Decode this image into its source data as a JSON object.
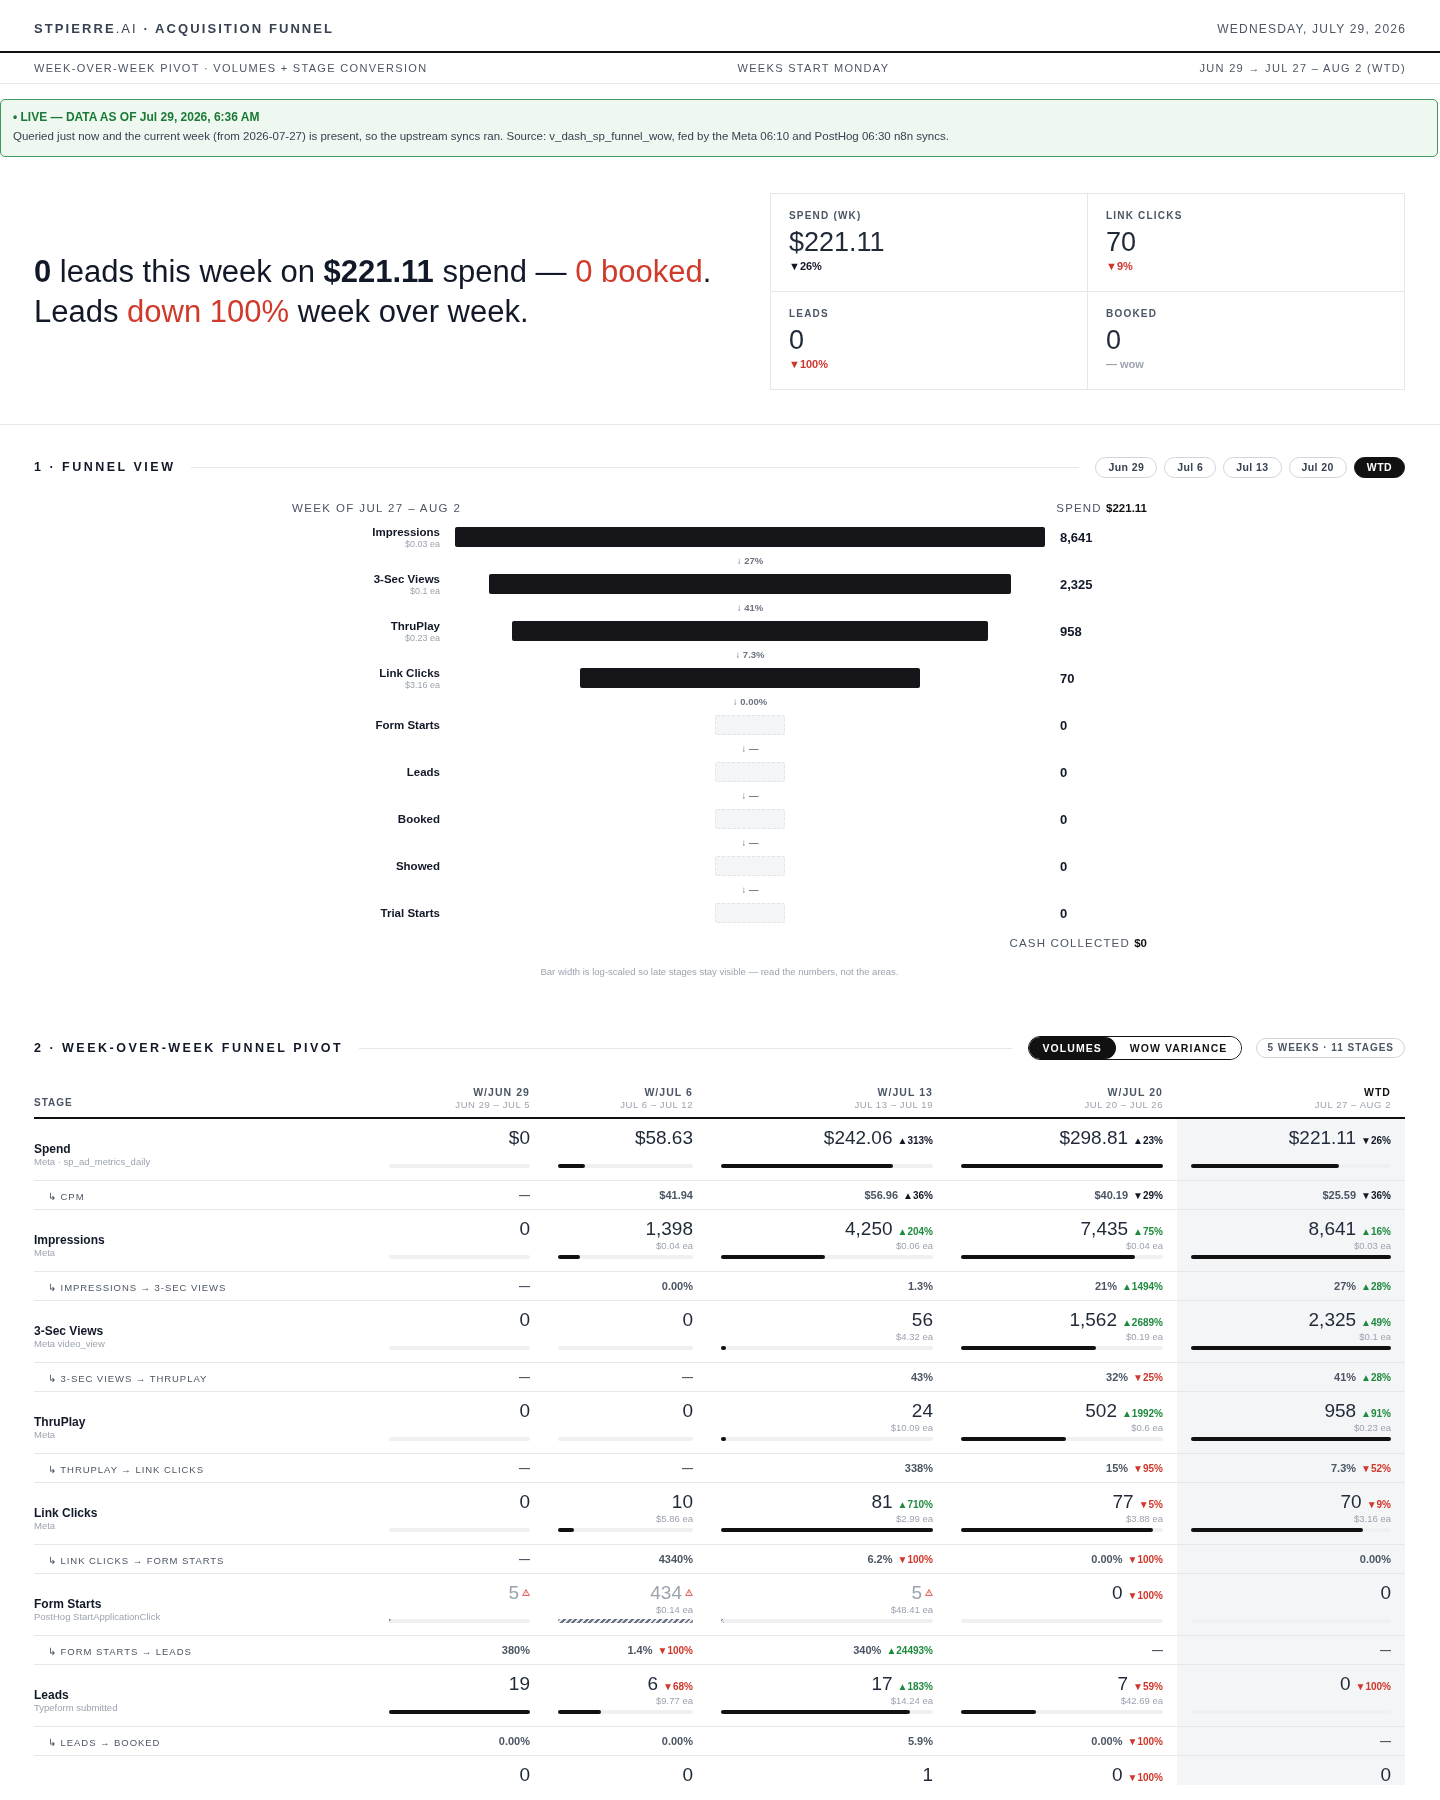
{
  "header": {
    "title": "**STPIERRE**.AI **· ACQUISITION FUNNEL**",
    "date": "WEDNESDAY, JULY 29, 2026"
  },
  "subheader": {
    "left": "WEEK-OVER-WEEK PIVOT · VOLUMES + STAGE CONVERSION",
    "center": "WEEKS START MONDAY",
    "right": "JUN 29 → JUL 27 – AUG 2 (WTD)"
  },
  "banner": {
    "status": "• LIVE — DATA AS OF Jul 29, 2026, 6:36 AM",
    "message": "Queried just now and the current week (from 2026-07-27) is present, so the upstream syncs ran. Source: v_dash_sp_funnel_wow, fed by the Meta 06:10 and PostHog 06:30 n8n syncs."
  },
  "hero": {
    "lines": [
      [
        {
          "text": "0",
          "kind": "strong"
        },
        {
          "text": " leads this week on ",
          "kind": "plain"
        },
        {
          "text": "$221.11",
          "kind": "strong"
        },
        {
          "text": " spend — ",
          "kind": "plain"
        },
        {
          "text": "0 booked",
          "kind": "alert"
        },
        {
          "text": ".",
          "kind": "plain"
        }
      ],
      [
        {
          "text": "Leads ",
          "kind": "plain"
        },
        {
          "text": "down 100%",
          "kind": "alert"
        },
        {
          "text": " week over week.",
          "kind": "plain"
        }
      ]
    ]
  },
  "kpis": [
    {
      "label": "SPEND (WK)",
      "value": "$221.11",
      "change": {
        "text": "▼26%",
        "color": "#111827"
      }
    },
    {
      "label": "LINK CLICKS",
      "value": "70",
      "change": {
        "text": "▼9%",
        "color": "#d0362a"
      }
    },
    {
      "label": "LEADS",
      "value": "0",
      "change": {
        "text": "▼100%",
        "color": "#d0362a"
      }
    },
    {
      "label": "BOOKED",
      "value": "0",
      "change": {
        "text": "— wow",
        "color": "#9ca3af"
      }
    }
  ],
  "funnel_view": {
    "title": "1 · FUNNEL VIEW",
    "weeks": [
      {
        "label": "Jun 29",
        "selected": false
      },
      {
        "label": "Jul 6",
        "selected": false
      },
      {
        "label": "Jul 13",
        "selected": false
      },
      {
        "label": "Jul 20",
        "selected": false
      },
      {
        "label": "WTD",
        "selected": true
      }
    ],
    "week_label": "WEEK OF JUL 27 – AUG 2",
    "spend_label": "SPEND",
    "spend_value": "$221.11",
    "stages": [
      {
        "name": "Impressions",
        "cost": "$0.03 ea",
        "value": "8,641",
        "step": "↓ 27%"
      },
      {
        "name": "3-Sec Views",
        "cost": "$0.1 ea",
        "value": "2,325",
        "step": "↓ 41%"
      },
      {
        "name": "ThruPlay",
        "cost": "$0.23 ea",
        "value": "958",
        "step": "↓ 7.3%"
      },
      {
        "name": "Link Clicks",
        "cost": "$3.16 ea",
        "value": "70",
        "step": "↓ 0.00%"
      },
      {
        "name": "Form Starts",
        "value": "0",
        "step": "↓ —"
      },
      {
        "name": "Leads",
        "value": "0",
        "step": "↓ —"
      },
      {
        "name": "Booked",
        "value": "0",
        "step": "↓ —"
      },
      {
        "name": "Showed",
        "value": "0",
        "step": "↓ —"
      },
      {
        "name": "Trial Starts",
        "value": "0"
      }
    ],
    "cash_label": "CASH COLLECTED",
    "cash_value": "$0",
    "note": "Bar width is log-scaled so late stages stay visible — read the numbers, not the areas."
  },
  "pivot": {
    "title": "2 · WEEK-OVER-WEEK FUNNEL PIVOT",
    "modes": [
      {
        "label": "VOLUMES",
        "selected": true
      },
      {
        "label": "WOW VARIANCE",
        "selected": false
      }
    ],
    "summary": "5 WEEKS · 11 STAGES",
    "stage_header": "STAGE",
    "columns": [
      {
        "title": "W/JUN 29",
        "range": "JUN 29 – JUL 5",
        "current": false
      },
      {
        "title": "W/JUL 6",
        "range": "JUL 6 – JUL 12",
        "current": false
      },
      {
        "title": "W/JUL 13",
        "range": "JUL 13 – JUL 19",
        "current": false
      },
      {
        "title": "W/JUL 20",
        "range": "JUL 20 – JUL 26",
        "current": false
      },
      {
        "title": "WTD",
        "range": "JUL 27 – AUG 2",
        "current": true
      }
    ],
    "rows": [
      {
        "kind": "metric",
        "name": "Spend",
        "source": "Meta · sp_ad_metrics_daily",
        "cells": [
          {
            "value": "$0"
          },
          {
            "value": "$58.63",
            "level": 0.2
          },
          {
            "value": "$242.06",
            "change": {
              "text": "▲313%",
              "color": "#111827"
            },
            "level": 0.81
          },
          {
            "value": "$298.81",
            "change": {
              "text": "▲23%",
              "color": "#111827"
            },
            "level": 1
          },
          {
            "value": "$221.11",
            "change": {
              "text": "▼26%",
              "color": "#111827"
            },
            "level": 0.74
          }
        ]
      },
      {
        "kind": "ratio",
        "name": "↳ CPM",
        "cells": [
          {
            "value": "—"
          },
          {
            "value": "$41.94"
          },
          {
            "value": "$56.96",
            "change": {
              "text": "▲36%",
              "color": "#111827"
            }
          },
          {
            "value": "$40.19",
            "change": {
              "text": "▼29%",
              "color": "#111827"
            }
          },
          {
            "value": "$25.59",
            "change": {
              "text": "▼36%",
              "color": "#111827"
            }
          }
        ]
      },
      {
        "kind": "metric",
        "name": "Impressions",
        "source": "Meta",
        "cells": [
          {
            "value": "0"
          },
          {
            "value": "1,398",
            "cost": "$0.04 ea",
            "level": 0.16
          },
          {
            "value": "4,250",
            "change": {
              "text": "▲204%",
              "color": "#1e8a3e"
            },
            "cost": "$0.06 ea",
            "level": 0.49
          },
          {
            "value": "7,435",
            "change": {
              "text": "▲75%",
              "color": "#1e8a3e"
            },
            "cost": "$0.04 ea",
            "level": 0.86
          },
          {
            "value": "8,641",
            "change": {
              "text": "▲16%",
              "color": "#1e8a3e"
            },
            "cost": "$0.03 ea",
            "level": 1
          }
        ]
      },
      {
        "kind": "ratio",
        "name": "↳ IMPRESSIONS → 3-SEC VIEWS",
        "cells": [
          {
            "value": "—"
          },
          {
            "value": "0.00%"
          },
          {
            "value": "1.3%"
          },
          {
            "value": "21%",
            "change": {
              "text": "▲1494%",
              "color": "#1e8a3e"
            }
          },
          {
            "value": "27%",
            "change": {
              "text": "▲28%",
              "color": "#1e8a3e"
            }
          }
        ]
      },
      {
        "kind": "metric",
        "name": "3-Sec Views",
        "source": "Meta video_view",
        "cells": [
          {
            "value": "0"
          },
          {
            "value": "0"
          },
          {
            "value": "56",
            "cost": "$4.32 ea",
            "level": 0.024
          },
          {
            "value": "1,562",
            "change": {
              "text": "▲2689%",
              "color": "#1e8a3e"
            },
            "cost": "$0.19 ea",
            "level": 0.67
          },
          {
            "value": "2,325",
            "change": {
              "text": "▲49%",
              "color": "#1e8a3e"
            },
            "cost": "$0.1 ea",
            "level": 1
          }
        ]
      },
      {
        "kind": "ratio",
        "name": "↳ 3-SEC VIEWS → THRUPLAY",
        "cells": [
          {
            "value": "—"
          },
          {
            "value": "—"
          },
          {
            "value": "43%"
          },
          {
            "value": "32%",
            "change": {
              "text": "▼25%",
              "color": "#d0362a"
            }
          },
          {
            "value": "41%",
            "change": {
              "text": "▲28%",
              "color": "#1e8a3e"
            }
          }
        ]
      },
      {
        "kind": "metric",
        "name": "ThruPlay",
        "source": "Meta",
        "cells": [
          {
            "value": "0"
          },
          {
            "value": "0"
          },
          {
            "value": "24",
            "cost": "$10.09 ea",
            "level": 0.025
          },
          {
            "value": "502",
            "change": {
              "text": "▲1992%",
              "color": "#1e8a3e"
            },
            "cost": "$0.6 ea",
            "level": 0.52
          },
          {
            "value": "958",
            "change": {
              "text": "▲91%",
              "color": "#1e8a3e"
            },
            "cost": "$0.23 ea",
            "level": 1
          }
        ]
      },
      {
        "kind": "ratio",
        "name": "↳ THRUPLAY → LINK CLICKS",
        "cells": [
          {
            "value": "—"
          },
          {
            "value": "—"
          },
          {
            "value": "338%"
          },
          {
            "value": "15%",
            "change": {
              "text": "▼95%",
              "color": "#d0362a"
            }
          },
          {
            "value": "7.3%",
            "change": {
              "text": "▼52%",
              "color": "#d0362a"
            }
          }
        ]
      },
      {
        "kind": "metric",
        "name": "Link Clicks",
        "source": "Meta",
        "cells": [
          {
            "value": "0"
          },
          {
            "value": "10",
            "cost": "$5.86 ea",
            "level": 0.12
          },
          {
            "value": "81",
            "change": {
              "text": "▲710%",
              "color": "#1e8a3e"
            },
            "cost": "$2.99 ea",
            "level": 1
          },
          {
            "value": "77",
            "change": {
              "text": "▼5%",
              "color": "#d0362a"
            },
            "cost": "$3.88 ea",
            "level": 0.95
          },
          {
            "value": "70",
            "change": {
              "text": "▼9%",
              "color": "#d0362a"
            },
            "cost": "$3.16 ea",
            "level": 0.86
          }
        ]
      },
      {
        "kind": "ratio",
        "name": "↳ LINK CLICKS → FORM STARTS",
        "cells": [
          {
            "value": "—"
          },
          {
            "value": "4340%"
          },
          {
            "value": "6.2%",
            "change": {
              "text": "▼100%",
              "color": "#d0362a"
            }
          },
          {
            "value": "0.00%",
            "change": {
              "text": "▼100%",
              "color": "#d0362a"
            }
          },
          {
            "value": "0.00%"
          }
        ]
      },
      {
        "kind": "metric",
        "name": "Form Starts",
        "source": "PostHog StartApplicationClick",
        "cells": [
          {
            "value": "5",
            "flagged": true,
            "level": 0.012
          },
          {
            "value": "434",
            "flagged": true,
            "cost": "$0.14 ea",
            "level": 1
          },
          {
            "value": "5",
            "flagged": true,
            "cost": "$48.41 ea",
            "level": 0.012
          },
          {
            "value": "0",
            "flagged": false,
            "change": {
              "text": "▼100%",
              "color": "#d0362a"
            }
          },
          {
            "value": "0",
            "flagged": false
          }
        ]
      },
      {
        "kind": "ratio",
        "name": "↳ FORM STARTS → LEADS",
        "cells": [
          {
            "value": "380%"
          },
          {
            "value": "1.4%",
            "change": {
              "text": "▼100%",
              "color": "#d0362a"
            }
          },
          {
            "value": "340%",
            "change": {
              "text": "▲24493%",
              "color": "#1e8a3e"
            }
          },
          {
            "value": "—"
          },
          {
            "value": "—"
          }
        ]
      },
      {
        "kind": "metric",
        "name": "Leads",
        "source": "Typeform submitted",
        "cells": [
          {
            "value": "19",
            "level": 1
          },
          {
            "value": "6",
            "change": {
              "text": "▼68%",
              "color": "#d0362a"
            },
            "cost": "$9.77 ea",
            "level": 0.32
          },
          {
            "value": "17",
            "change": {
              "text": "▲183%",
              "color": "#1e8a3e"
            },
            "cost": "$14.24 ea",
            "level": 0.89
          },
          {
            "value": "7",
            "change": {
              "text": "▼59%",
              "color": "#d0362a"
            },
            "cost": "$42.69 ea",
            "level": 0.37
          },
          {
            "value": "0",
            "change": {
              "text": "▼100%",
              "color": "#d0362a"
            }
          }
        ]
      },
      {
        "kind": "ratio",
        "name": "↳ LEADS → BOOKED",
        "cells": [
          {
            "value": "0.00%"
          },
          {
            "value": "0.00%"
          },
          {
            "value": "5.9%"
          },
          {
            "value": "0.00%",
            "change": {
              "text": "▼100%",
              "color": "#d0362a"
            }
          },
          {
            "value": "—"
          }
        ]
      },
      {
        "kind": "metric",
        "cells": [
          {
            "value": "0"
          },
          {
            "value": "0"
          },
          {
            "value": "1"
          },
          {
            "value": "0",
            "change": {
              "text": "▼100%",
              "color": "#d0362a"
            }
          },
          {
            "value": "0"
          }
        ]
      }
    ]
  }
}
